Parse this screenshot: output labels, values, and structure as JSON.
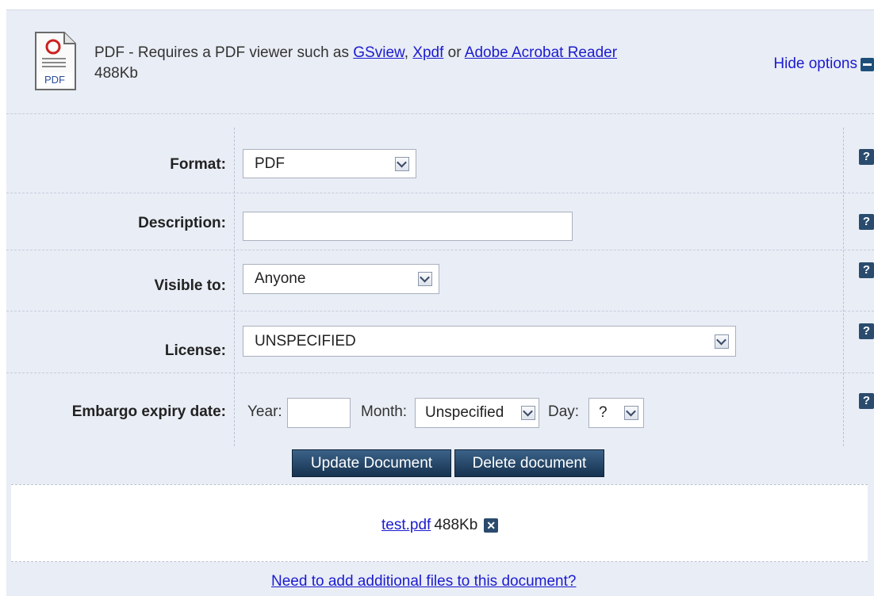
{
  "header": {
    "file_type_icon": "pdf-file-icon",
    "requires_text": "PDF - Requires a PDF viewer such as",
    "viewer_links": [
      "GSview",
      "Xpdf",
      "Adobe Acrobat Reader"
    ],
    "separator_comma": ",",
    "separator_or": "or",
    "file_size": "488Kb",
    "hide_options_label": "Hide options",
    "hide_options_icon": "minus-icon"
  },
  "form": {
    "format": {
      "label": "Format:",
      "value": "PDF"
    },
    "description": {
      "label": "Description:",
      "value": ""
    },
    "visible_to": {
      "label": "Visible to:",
      "value": "Anyone"
    },
    "license": {
      "label": "License:",
      "value": "UNSPECIFIED"
    },
    "embargo": {
      "label": "Embargo expiry date:",
      "year_label": "Year:",
      "year_value": "",
      "month_label": "Month:",
      "month_value": "Unspecified",
      "day_label": "Day:",
      "day_value": "?"
    },
    "help_glyph": "?",
    "help_icon": "help-icon"
  },
  "buttons": {
    "update": "Update Document",
    "delete": "Delete document"
  },
  "files": {
    "name": "test.pdf",
    "size": "488Kb",
    "remove_glyph": "✕",
    "remove_icon": "close-icon"
  },
  "add_more_link": "Need to add additional files to this document?",
  "colors": {
    "panel_bg": "#e9edf5",
    "link": "#1b1bd0",
    "button_bg": "#1f4166",
    "help_bg": "#2a4b6d"
  }
}
